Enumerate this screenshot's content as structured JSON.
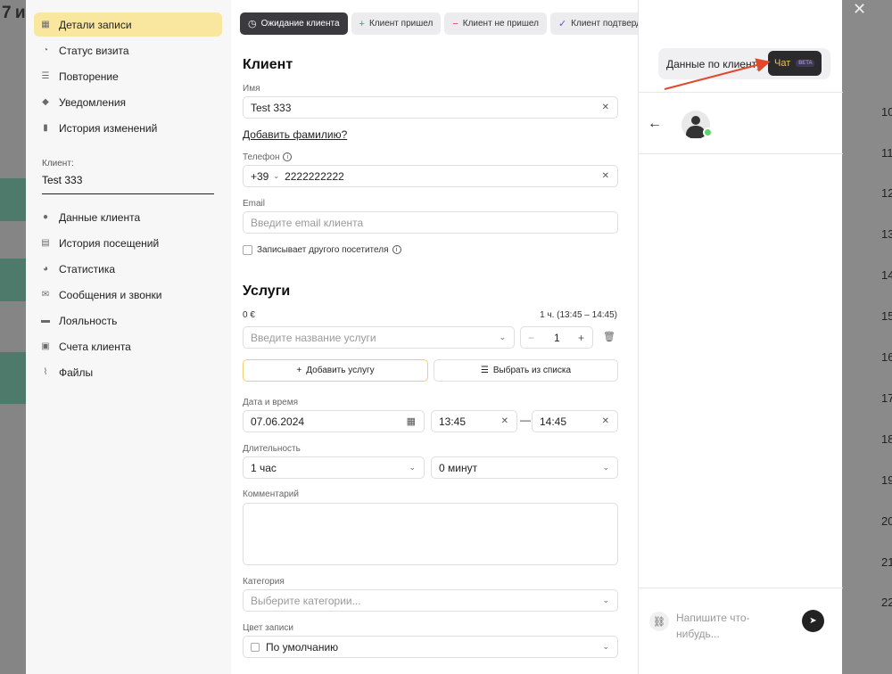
{
  "background": {
    "title": "7 и",
    "hours": [
      "10",
      "11",
      "12",
      "13",
      "14",
      "15",
      "16",
      "17",
      "18",
      "19",
      "20",
      "21",
      "22"
    ]
  },
  "sidebar": {
    "items": [
      {
        "label": "Детали записи",
        "icon": "calendar-icon"
      },
      {
        "label": "Статус визита",
        "icon": "clock-icon"
      },
      {
        "label": "Повторение",
        "icon": "list-icon"
      },
      {
        "label": "Уведомления",
        "icon": "chat-icon"
      },
      {
        "label": "История изменений",
        "icon": "document-icon"
      },
      {
        "label": "Данные клиента",
        "icon": "user-icon"
      },
      {
        "label": "История посещений",
        "icon": "table-icon"
      },
      {
        "label": "Статистика",
        "icon": "pie-chart-icon"
      },
      {
        "label": "Сообщения и звонки",
        "icon": "envelope-icon"
      },
      {
        "label": "Лояльность",
        "icon": "card-icon"
      },
      {
        "label": "Счета клиента",
        "icon": "briefcase-icon"
      },
      {
        "label": "Файлы",
        "icon": "paperclip-icon"
      }
    ],
    "client_label": "Клиент:",
    "client_name": "Test 333"
  },
  "status_buttons": [
    {
      "label": "Ожидание клиента",
      "icon": "clock-icon"
    },
    {
      "label": "Клиент пришел",
      "icon": "plus-icon"
    },
    {
      "label": "Клиент не пришел",
      "icon": "minus-icon"
    },
    {
      "label": "Клиент подтвердил",
      "icon": "check-icon"
    }
  ],
  "client": {
    "heading": "Клиент",
    "name_label": "Имя",
    "name_value": "Test 333",
    "add_surname": "Добавить фамилию?",
    "phone_label": "Телефон",
    "phone_code": "+39",
    "phone_value": "2222222222",
    "email_label": "Email",
    "email_placeholder": "Введите email клиента",
    "other_visitor": "Записывает другого посетителя"
  },
  "services": {
    "heading": "Услуги",
    "price": "0 €",
    "duration_summary": "1 ч. (13:45 – 14:45)",
    "service_placeholder": "Введите название услуги",
    "quantity": "1",
    "add_button": "Добавить услугу",
    "choose_button": "Выбрать из списка"
  },
  "datetime": {
    "label": "Дата и время",
    "date": "07.06.2024",
    "start": "13:45",
    "end": "14:45",
    "dash": "—"
  },
  "duration": {
    "label": "Длительность",
    "hours": "1 час",
    "minutes": "0 минут"
  },
  "comment": {
    "label": "Комментарий"
  },
  "category": {
    "label": "Категория",
    "placeholder": "Выберите категории..."
  },
  "color": {
    "label": "Цвет записи",
    "value": "По умолчанию"
  },
  "right_panel": {
    "client_data_tab": "Данные по клиенту",
    "chat_tab": "Чат",
    "beta": "BETA",
    "message_placeholder": "Напишите что-нибудь..."
  }
}
